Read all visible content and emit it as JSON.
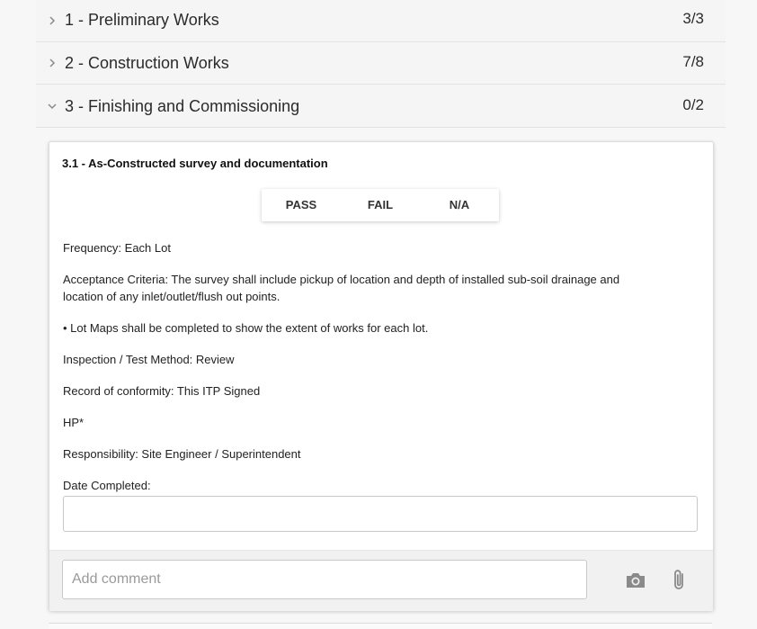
{
  "sections": [
    {
      "label": "1 - Preliminary Works",
      "count": "3/3",
      "expanded": false
    },
    {
      "label": "2 - Construction Works",
      "count": "7/8",
      "expanded": false
    },
    {
      "label": "3 - Finishing and Commissioning",
      "count": "0/2",
      "expanded": true
    }
  ],
  "item": {
    "title": "3.1 - As-Constructed survey and documentation",
    "options": [
      "PASS",
      "FAIL",
      "N/A"
    ],
    "frequency": "Frequency: Each Lot",
    "acceptance_line1": "Acceptance Criteria: The survey shall include pickup of location and depth of installed sub-soil drainage and",
    "acceptance_line2": "location of any inlet/outlet/flush out points.",
    "lot_maps": "• Lot Maps shall be completed to show the extent of works for each lot.",
    "inspection": "Inspection / Test Method: Review",
    "record": "Record of conformity: This ITP Signed",
    "hold_point": "HP*",
    "responsibility": "Responsibility: Site Engineer / Superintendent",
    "date_label": "Date Completed:",
    "date_value": ""
  },
  "comment": {
    "placeholder": "Add comment",
    "value": ""
  },
  "icons": {
    "collapsed": "chevron-right-icon",
    "expanded": "chevron-down-icon",
    "camera": "camera-icon",
    "attach": "paperclip-icon"
  },
  "colors": {
    "page_bg": "#f7f7f7",
    "icon_gray": "#8a8a8a"
  }
}
